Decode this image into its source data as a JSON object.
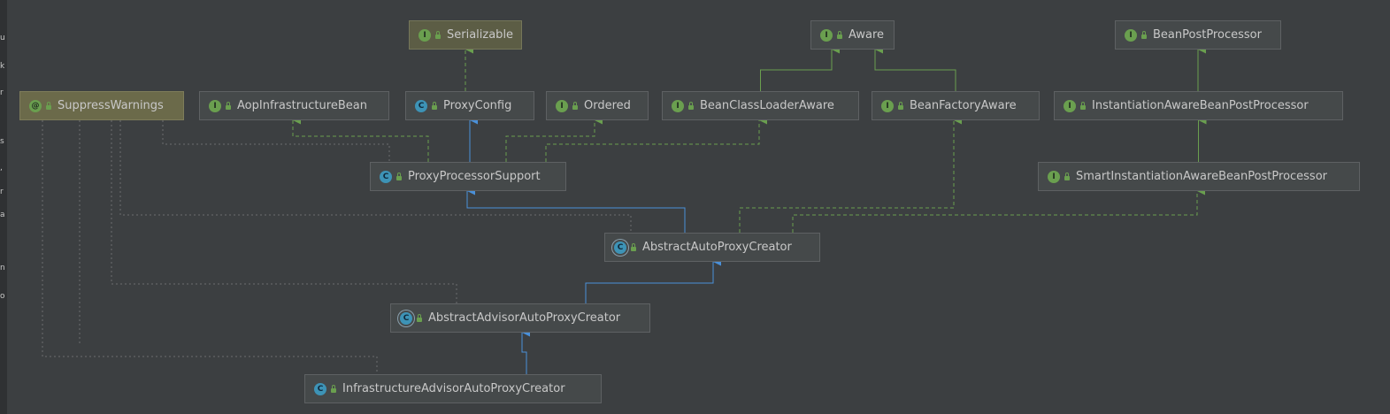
{
  "colors": {
    "background": "#3c3f41",
    "node_fill": "#45494a",
    "implements_edge": "#6a9f4f",
    "extends_edge": "#4a90d9",
    "dependency_edge": "#6b6e70"
  },
  "nodes": [
    {
      "id": "serializable",
      "label": "Serializable",
      "kind": "interface",
      "icon": "interface-icon"
    },
    {
      "id": "aware",
      "label": "Aware",
      "kind": "interface",
      "icon": "interface-icon"
    },
    {
      "id": "beanpostprocessor",
      "label": "BeanPostProcessor",
      "kind": "interface",
      "icon": "interface-icon"
    },
    {
      "id": "suppresswarnings",
      "label": "SuppressWarnings",
      "kind": "annotation",
      "icon": "annotation-icon"
    },
    {
      "id": "aopinfrastructurebean",
      "label": "AopInfrastructureBean",
      "kind": "interface",
      "icon": "interface-icon"
    },
    {
      "id": "proxyconfig",
      "label": "ProxyConfig",
      "kind": "class",
      "icon": "class-icon"
    },
    {
      "id": "ordered",
      "label": "Ordered",
      "kind": "interface",
      "icon": "interface-icon"
    },
    {
      "id": "beanclassloaderaware",
      "label": "BeanClassLoaderAware",
      "kind": "interface",
      "icon": "interface-icon"
    },
    {
      "id": "beanfactoryaware",
      "label": "BeanFactoryAware",
      "kind": "interface",
      "icon": "interface-icon"
    },
    {
      "id": "instantiationawarebeanpostprocessor",
      "label": "InstantiationAwareBeanPostProcessor",
      "kind": "interface",
      "icon": "interface-icon"
    },
    {
      "id": "proxyprocessorsupport",
      "label": "ProxyProcessorSupport",
      "kind": "class",
      "icon": "class-icon"
    },
    {
      "id": "smartinstantiationawarebeanpostprocessor",
      "label": "SmartInstantiationAwareBeanPostProcessor",
      "kind": "interface",
      "icon": "interface-icon"
    },
    {
      "id": "abstractautoproxycreator",
      "label": "AbstractAutoProxyCreator",
      "kind": "abstract",
      "icon": "abstract-class-icon"
    },
    {
      "id": "abstractadvisorautoproxycreator",
      "label": "AbstractAdvisorAutoProxyCreator",
      "kind": "abstract",
      "icon": "abstract-class-icon"
    },
    {
      "id": "infrastructureadvisorautoproxycreator",
      "label": "InfrastructureAdvisorAutoProxyCreator",
      "kind": "class",
      "icon": "class-icon"
    }
  ],
  "edges": [
    {
      "from": "proxyconfig",
      "to": "serializable",
      "type": "implements"
    },
    {
      "from": "beanclassloaderaware",
      "to": "aware",
      "type": "extends-interface"
    },
    {
      "from": "beanfactoryaware",
      "to": "aware",
      "type": "extends-interface"
    },
    {
      "from": "instantiationawarebeanpostprocessor",
      "to": "beanpostprocessor",
      "type": "extends-interface"
    },
    {
      "from": "smartinstantiationawarebeanpostprocessor",
      "to": "instantiationawarebeanpostprocessor",
      "type": "extends-interface"
    },
    {
      "from": "proxyprocessorsupport",
      "to": "proxyconfig",
      "type": "extends"
    },
    {
      "from": "proxyprocessorsupport",
      "to": "aopinfrastructurebean",
      "type": "implements"
    },
    {
      "from": "proxyprocessorsupport",
      "to": "ordered",
      "type": "implements"
    },
    {
      "from": "proxyprocessorsupport",
      "to": "beanclassloaderaware",
      "type": "implements"
    },
    {
      "from": "abstractautoproxycreator",
      "to": "proxyprocessorsupport",
      "type": "extends"
    },
    {
      "from": "abstractautoproxycreator",
      "to": "beanfactoryaware",
      "type": "implements"
    },
    {
      "from": "abstractautoproxycreator",
      "to": "smartinstantiationawarebeanpostprocessor",
      "type": "implements"
    },
    {
      "from": "abstractadvisorautoproxycreator",
      "to": "abstractautoproxycreator",
      "type": "extends"
    },
    {
      "from": "infrastructureadvisorautoproxycreator",
      "to": "abstractadvisorautoproxycreator",
      "type": "extends"
    }
  ],
  "gutter_marks": [
    "u",
    "k",
    "r",
    "s",
    ",",
    "r",
    "a",
    "n",
    "o"
  ]
}
